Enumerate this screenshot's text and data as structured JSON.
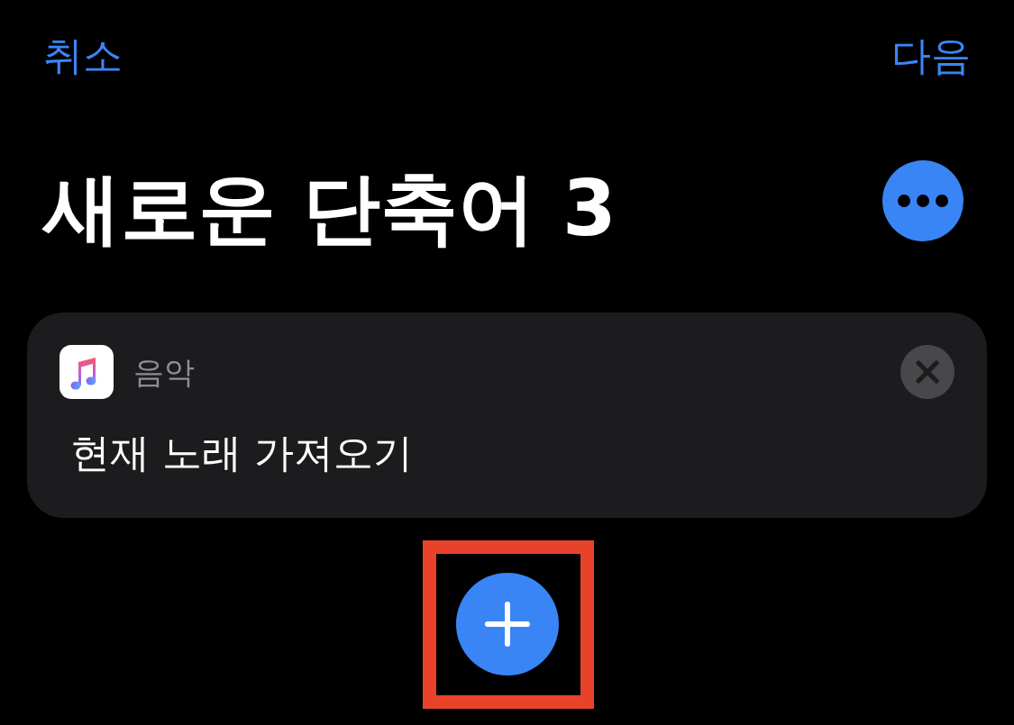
{
  "nav": {
    "cancel": "취소",
    "next": "다음"
  },
  "title": "새로운 단축어 3",
  "actions": [
    {
      "app": "음악",
      "label": "현재 노래 가져오기"
    }
  ],
  "add_button": {
    "highlighted": true
  }
}
